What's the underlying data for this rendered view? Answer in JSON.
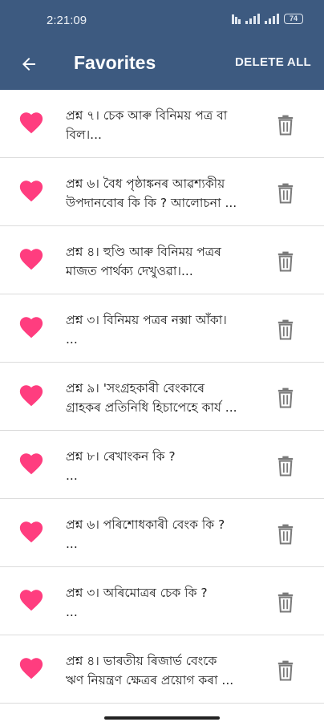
{
  "status_bar": {
    "time": "2:21:09",
    "battery": "74"
  },
  "header": {
    "title": "Favorites",
    "delete_all_label": "DELETE ALL",
    "back_icon": "arrow-left-icon"
  },
  "colors": {
    "appbar": "#3d5a80",
    "heart": "#ff3d7f",
    "trash": "#7a7a7a"
  },
  "items": [
    {
      "line1": "প্ৰশ্ন ৭। চেক আৰু বিনিময় পত্ৰ বা",
      "line2": "বিল।..."
    },
    {
      "line1": "প্ৰশ্ন ৬। বৈধ পৃষ্ঠাঙ্কনৰ আৱশ্যকীয়",
      "line2": "উপদানবোৰ কি কি ? আলোচনা ..."
    },
    {
      "line1": "প্ৰশ্ন ৪। হুণ্ডি আৰু বিনিময় পত্ৰৰ",
      "line2": "মাজত পাৰ্থক্য দেখুওৱা।..."
    },
    {
      "line1": "প্ৰশ্ন ৩। বিনিময় পত্ৰৰ নক্সা আঁকা।",
      "line2": "..."
    },
    {
      "line1": "প্ৰশ্ন ৯। 'সংগ্ৰহকাৰী বেংকাৰে",
      "line2": "গ্ৰাহকৰ প্ৰতিনিধি হিচাপেহে কাৰ্য ..."
    },
    {
      "line1": "প্ৰশ্ন ৮। ৰেখাংকন কি ?",
      "line2": "..."
    },
    {
      "line1": "প্ৰশ্ন ৬। পৰিশোধকাৰী বেংক কি ?",
      "line2": "..."
    },
    {
      "line1": "প্ৰশ্ন ৩। অৰিমোত্ৰৰ চেক কি ?",
      "line2": "..."
    },
    {
      "line1": "প্ৰশ্ন ৪। ভাৰতীয় ৰিজাৰ্ভ বেংকে",
      "line2": "ঋণ নিয়ন্ত্ৰণ ক্ষেত্ৰৰ প্ৰয়োগ কৰা ..."
    }
  ]
}
